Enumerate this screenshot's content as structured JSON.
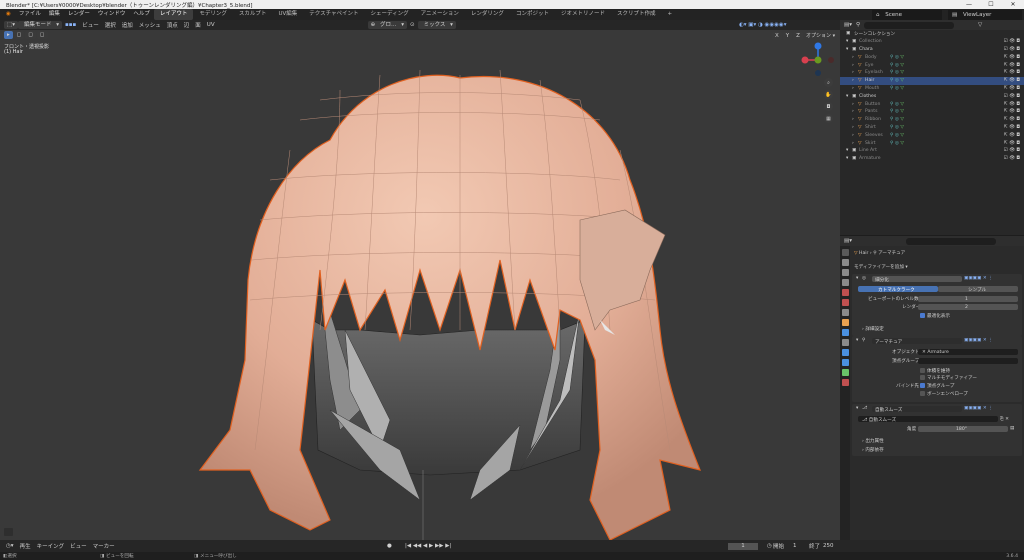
{
  "window": {
    "title": "Blender* [C:¥Users¥0000¥Desktop¥blender（トゥーンレンダリング編）¥Chapter3_5.blend]",
    "minimize": "—",
    "maximize": "☐",
    "close": "✕"
  },
  "menu": {
    "items": [
      "ファイル",
      "編集",
      "レンダー",
      "ウィンドウ",
      "ヘルプ"
    ],
    "tabs": [
      "レイアウト",
      "モデリング",
      "スカルプト",
      "UV編集",
      "テクスチャペイント",
      "シェーディング",
      "アニメーション",
      "レンダリング",
      "コンポジット",
      "ジオメトリノード",
      "スクリプト作成"
    ],
    "add_tab": "+",
    "scene_label": "Scene",
    "view_layer_label": "ViewLayer"
  },
  "viewport_header": {
    "mode": "編集モード",
    "menus": [
      "ビュー",
      "選択",
      "追加",
      "メッシュ",
      "頂点",
      "辺",
      "面",
      "UV"
    ],
    "transform": "グロ…",
    "mix": "ミックス",
    "options": "オプション",
    "xyz": [
      "X",
      "Y",
      "Z"
    ]
  },
  "viewport": {
    "view_name": "フロント・透視投影",
    "object_name": "(1) Hair",
    "gizmo_labels": {
      "z": "Z",
      "x": "X",
      "y": "Y"
    }
  },
  "outliner": {
    "title": "シーンコレクション",
    "rows": [
      {
        "name": "Collection",
        "depth": 1,
        "dim": true
      },
      {
        "name": "Chara",
        "depth": 1
      },
      {
        "name": "Body",
        "depth": 2,
        "dim": true
      },
      {
        "name": "Eye",
        "depth": 2,
        "dim": true
      },
      {
        "name": "Eyelash",
        "depth": 2,
        "dim": true
      },
      {
        "name": "Hair",
        "depth": 2,
        "selected": true
      },
      {
        "name": "Mouth",
        "depth": 2,
        "dim": true
      },
      {
        "name": "Clothes",
        "depth": 1
      },
      {
        "name": "Button",
        "depth": 2,
        "dim": true
      },
      {
        "name": "Pants",
        "depth": 2,
        "dim": true
      },
      {
        "name": "Ribbon",
        "depth": 2,
        "dim": true
      },
      {
        "name": "Shirt",
        "depth": 2,
        "dim": true
      },
      {
        "name": "Sleeves",
        "depth": 2,
        "dim": true
      },
      {
        "name": "Skirt",
        "depth": 2,
        "dim": true
      },
      {
        "name": "Line Art",
        "depth": 1,
        "dim": true
      },
      {
        "name": "Armature",
        "depth": 1,
        "dim": true
      }
    ]
  },
  "properties": {
    "breadcrumb": {
      "object": "Hair",
      "modifier": "アーマチュア"
    },
    "add_modifier": "モディファイアーを追加",
    "subsurf": {
      "name": "細分化",
      "tab_catmull": "カトマルクラーク",
      "tab_simple": "シンプル",
      "levels_viewport_label": "ビューポートのレベル数",
      "levels_viewport": "1",
      "render_label": "レンダー",
      "render": "2",
      "optimal_label": "最適化表示",
      "advanced": "詳細設定"
    },
    "armature": {
      "name": "アーマチュア",
      "object_label": "オブジェクト",
      "object": "Armature",
      "vgroup_label": "頂点グループ",
      "preserve_volume": "体積を維持",
      "multi_modifier": "マルチモディファイアー",
      "bind_label": "バインド先",
      "bind_vgroups": "頂点グループ",
      "bind_envelope": "ボーンエンベロープ"
    },
    "smooth": {
      "name": "自動スムーズ",
      "node": "自動スムーズ",
      "angle_label": "角度",
      "angle": "180°",
      "output_attrs": "出力属性",
      "internal_deps": "内部依存"
    }
  },
  "timeline": {
    "items": [
      "再生",
      "キーイング",
      "ビュー",
      "マーカー"
    ],
    "frame": "1",
    "start_label": "開始",
    "start": "1",
    "end_label": "終了",
    "end": "250"
  },
  "status": {
    "items": [
      "選択",
      "ビューを回転",
      "メニュー呼び出し"
    ],
    "version": "3.6.4"
  }
}
